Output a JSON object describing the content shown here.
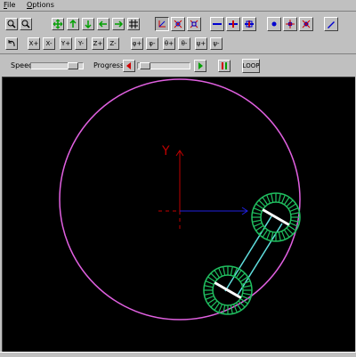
{
  "menu": {
    "file": {
      "mnemonic": "F",
      "rest": "ile"
    },
    "options": {
      "mnemonic": "O",
      "rest": "ptions"
    }
  },
  "toolbar_row2": {
    "x_plus": "X+",
    "x_minus": "X-",
    "y_plus": "Y+",
    "y_minus": "Y-",
    "z_plus": "Z+",
    "z_minus": "Z-",
    "phi_plus": "φ+",
    "phi_minus": "φ-",
    "theta_plus": "θ+",
    "theta_minus": "θ-",
    "psi_plus": "ψ+",
    "psi_minus": "ψ-"
  },
  "controls": {
    "speed_label": "Speed",
    "progress_label": "Progress",
    "loop_label": "LOOP",
    "speed_value": 0.9,
    "progress_value": 0.05
  },
  "canvas": {
    "axis_y_label": "Y"
  },
  "colors": {
    "circle": "#e060e0",
    "gear": "#20c060",
    "link": "#60e0e0",
    "axis_y": "#c00000",
    "axis_x": "#2020e0",
    "arrow_red": "#d00000",
    "arrow_green": "#00a000",
    "button_blue": "#0000d0"
  }
}
